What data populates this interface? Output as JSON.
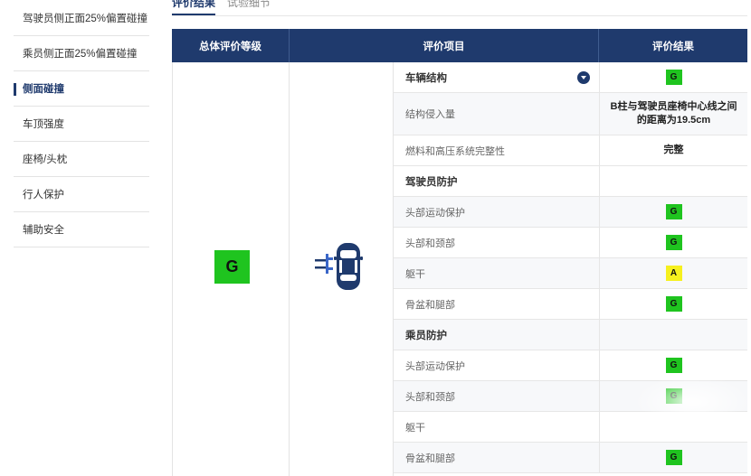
{
  "sidebar": {
    "items": [
      {
        "label": "驾驶员侧正面25%偏置碰撞",
        "active": false
      },
      {
        "label": "乘员侧正面25%偏置碰撞",
        "active": false
      },
      {
        "label": "侧面碰撞",
        "active": true
      },
      {
        "label": "车顶强度",
        "active": false
      },
      {
        "label": "座椅/头枕",
        "active": false
      },
      {
        "label": "行人保护",
        "active": false
      },
      {
        "label": "辅助安全",
        "active": false
      }
    ]
  },
  "tabs": [
    {
      "label": "评价结果",
      "active": true
    },
    {
      "label": "试验细节",
      "active": false
    }
  ],
  "table": {
    "headers": {
      "overall": "总体评价等级",
      "items": "评价项目",
      "result": "评价结果"
    },
    "overall_rating": "G",
    "rows": [
      {
        "item": "车辆结构",
        "section": true,
        "expandable": true,
        "badge": "G"
      },
      {
        "item": "结构侵入量",
        "result_text": "B柱与驾驶员座椅中心线之间的距离为19.5cm"
      },
      {
        "item": "燃料和高压系统完整性",
        "result_text": "完整"
      },
      {
        "item": "驾驶员防护",
        "section": true
      },
      {
        "item": "头部运动保护",
        "badge": "G"
      },
      {
        "item": "头部和颈部",
        "badge": "G"
      },
      {
        "item": "躯干",
        "badge": "A"
      },
      {
        "item": "骨盆和腿部",
        "badge": "G"
      },
      {
        "item": "乘员防护",
        "section": true
      },
      {
        "item": "头部运动保护",
        "badge": "G"
      },
      {
        "item": "头部和颈部",
        "badge": "G"
      },
      {
        "item": "躯干"
      },
      {
        "item": "骨盆和腿部",
        "badge": "G"
      }
    ]
  },
  "colors": {
    "header_bg": "#1f3a6d",
    "good": "#1fc41f",
    "acceptable": "#f6f01e"
  },
  "icons": {
    "overall_icon": "side-impact-car-icon",
    "expand": "chevron-down-icon"
  }
}
